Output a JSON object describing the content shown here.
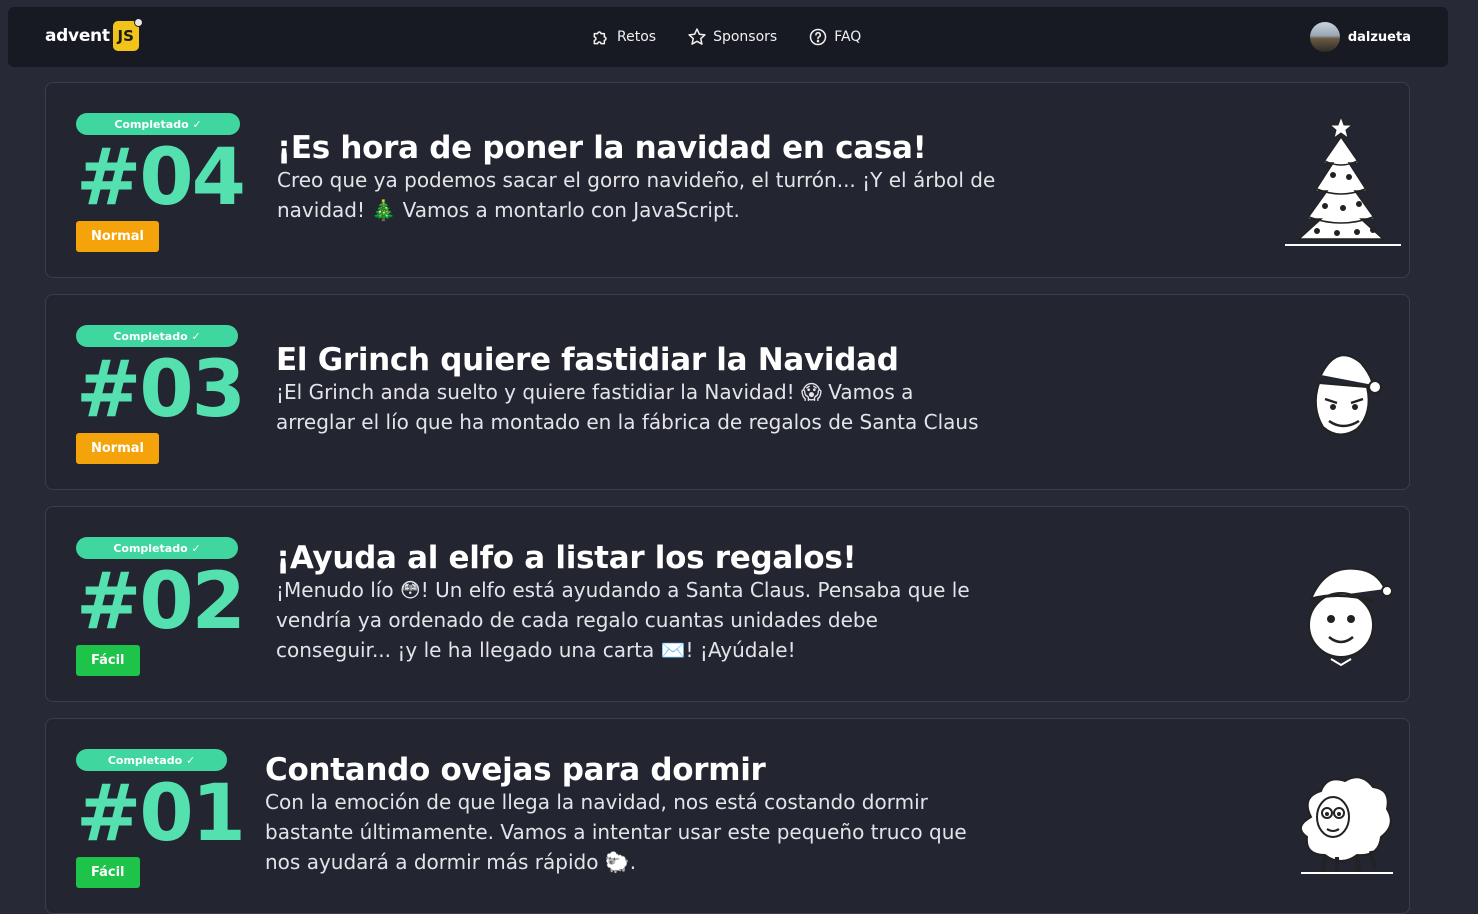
{
  "navbar": {
    "logo_text": "advent",
    "logo_badge": "JS",
    "links": [
      {
        "label": "Retos",
        "icon": "puzzle-icon"
      },
      {
        "label": "Sponsors",
        "icon": "star-icon"
      },
      {
        "label": "FAQ",
        "icon": "help-icon"
      }
    ],
    "username": "dalzueta"
  },
  "challenges": [
    {
      "status": "Completado ✓",
      "number": "#04",
      "level": "Normal",
      "title": "¡Es hora de poner la navidad en casa!",
      "description": "Creo que ya podemos sacar el gorro navideño, el turrón... ¡Y el árbol de navidad! 🎄 Vamos a montarlo con JavaScript.",
      "image": "christmas-tree-icon"
    },
    {
      "status": "Completado ✓",
      "number": "#03",
      "level": "Normal",
      "title": "El Grinch quiere fastidiar la Navidad",
      "description": "¡El Grinch anda suelto y quiere fastidiar la Navidad! 😱 Vamos a arreglar el lío que ha montado en la fábrica de regalos de Santa Claus",
      "image": "grinch-icon"
    },
    {
      "status": "Completado ✓",
      "number": "#02",
      "level": "Fácil",
      "title": "¡Ayuda al elfo a listar los regalos!",
      "description": "¡Menudo lío 😳! Un elfo está ayudando a Santa Claus. Pensaba que le vendría ya ordenado de cada regalo cuantas unidades debe conseguir... ¡y le ha llegado una carta ✉️! ¡Ayúdale!",
      "image": "elf-icon"
    },
    {
      "status": "Completado ✓",
      "number": "#01",
      "level": "Fácil",
      "title": "Contando ovejas para dormir",
      "description": "Con la emoción de que llega la navidad, nos está costando dormir bastante últimamente. Vamos a intentar usar este pequeño truco que nos ayudará a dormir más rápido 🐑.",
      "image": "sheep-icon"
    }
  ],
  "colors": {
    "background": "#272a36",
    "navbar": "#181a23",
    "accent_green": "#55e0b0",
    "completed_badge": "#3fd6a0",
    "normal_badge": "#f5a30a",
    "facil_badge": "#1ec34a",
    "logo_yellow": "#f2c419"
  }
}
